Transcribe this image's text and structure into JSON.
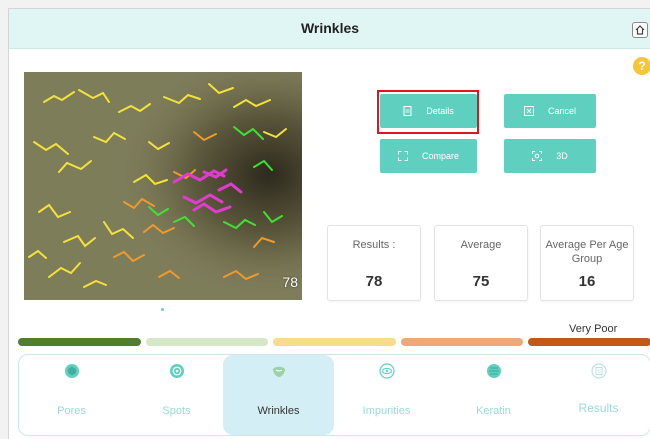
{
  "header": {
    "title": "Wrinkles"
  },
  "image": {
    "score": "78"
  },
  "actions": {
    "details": "Details",
    "cancel": "Cancel",
    "compare": "Compare",
    "threed": "3D"
  },
  "stats": [
    {
      "label": "Results :",
      "value": "78"
    },
    {
      "label": "Average",
      "value": "75"
    },
    {
      "label": "Average Per Age Group",
      "value": "16"
    }
  ],
  "rating": {
    "label": "Very Poor",
    "segments": [
      "#4f7f2b",
      "#d6e7c7",
      "#f9dc88",
      "#eea777",
      "#c2581a"
    ],
    "active_index": 4
  },
  "tabs": [
    {
      "label": "Pores",
      "icon": "pores-icon"
    },
    {
      "label": "Spots",
      "icon": "spots-icon"
    },
    {
      "label": "Wrinkles",
      "icon": "wrinkles-icon"
    },
    {
      "label": "Impurities",
      "icon": "impurities-icon"
    },
    {
      "label": "Keratin",
      "icon": "keratin-icon"
    },
    {
      "label": "Results",
      "icon": "results-icon"
    }
  ],
  "active_tab": "Wrinkles",
  "colors": {
    "accent": "#5fd0c0",
    "header_bg": "#dff6f4",
    "highlight": "#e0161f",
    "help": "#f4c63a"
  }
}
